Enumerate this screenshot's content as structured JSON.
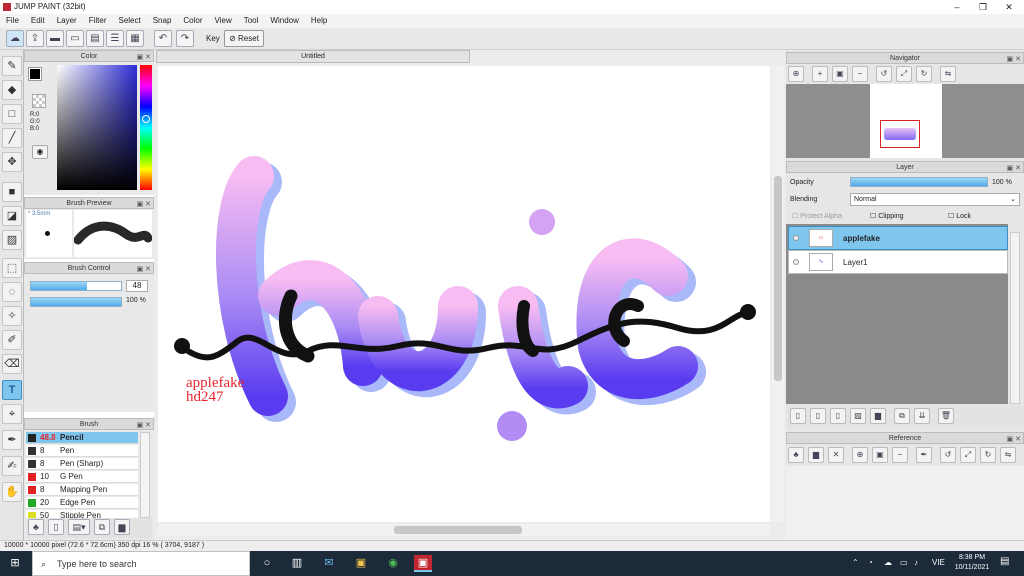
{
  "window": {
    "title": "JUMP PAINT (32bit)",
    "minimize": "–",
    "maximize": "❐",
    "close": "✕"
  },
  "menu": [
    "File",
    "Edit",
    "Layer",
    "Filter",
    "Select",
    "Snap",
    "Color",
    "View",
    "Tool",
    "Window",
    "Help"
  ],
  "toolbar": {
    "key_label": "Key",
    "reset_label": "Reset"
  },
  "panels": {
    "color_title": "Color",
    "color_values": {
      "r": "R:0",
      "g": "G:0",
      "b": "B:0"
    },
    "brush_preview_title": "Brush Preview",
    "brush_preview_size": "* 3.5mm",
    "brush_control_title": "Brush Control",
    "brush_size": "48",
    "brush_size_level": 0.62,
    "brush_opacity": "100 %",
    "brush_opacity_level": 1.0,
    "brush_title": "Brush",
    "brushes": [
      {
        "size": "48.8",
        "name": "Pencil",
        "color": "#222222",
        "selected": true
      },
      {
        "size": "8",
        "name": "Pen",
        "color": "#333333",
        "selected": false
      },
      {
        "size": "8",
        "name": "Pen (Sharp)",
        "color": "#333333",
        "selected": false
      },
      {
        "size": "10",
        "name": "G Pen",
        "color": "#e22222",
        "selected": false
      },
      {
        "size": "8",
        "name": "Mapping Pen",
        "color": "#e22222",
        "selected": false
      },
      {
        "size": "20",
        "name": "Edge Pen",
        "color": "#22aa22",
        "selected": false
      },
      {
        "size": "50",
        "name": "Stipple Pen",
        "color": "#dddd22",
        "selected": false
      }
    ]
  },
  "document": {
    "tab_title": "Untitled",
    "watermark_line1": "applefake",
    "watermark_line2": "hd247"
  },
  "navigator": {
    "title": "Navigator"
  },
  "layer_panel": {
    "title": "Layer",
    "opacity_label": "Opacity",
    "opacity_value": "100 %",
    "opacity_level": 1.0,
    "blending_label": "Blending",
    "blending_value": "Normal",
    "protect_alpha": "Protect Alpha",
    "clipping": "Clipping",
    "lock": "Lock",
    "layers": [
      {
        "name": "applefake",
        "selected": true
      },
      {
        "name": "Layer1",
        "selected": false
      }
    ]
  },
  "reference": {
    "title": "Reference"
  },
  "status": {
    "text": "10000 * 10000 pixel  (72.6 * 72.6cm)  350 dpi  16 %  ( 3704, 9187 )"
  },
  "taskbar": {
    "search_placeholder": "Type here to search",
    "language": "VIE",
    "time": "8:38 PM",
    "date": "10/11/2021"
  },
  "colors": {
    "accent": "#7fc6ee",
    "watermark": "#e8262d",
    "lettering_top": "#f7b8f3",
    "lettering_bottom": "#5a3cf0"
  }
}
